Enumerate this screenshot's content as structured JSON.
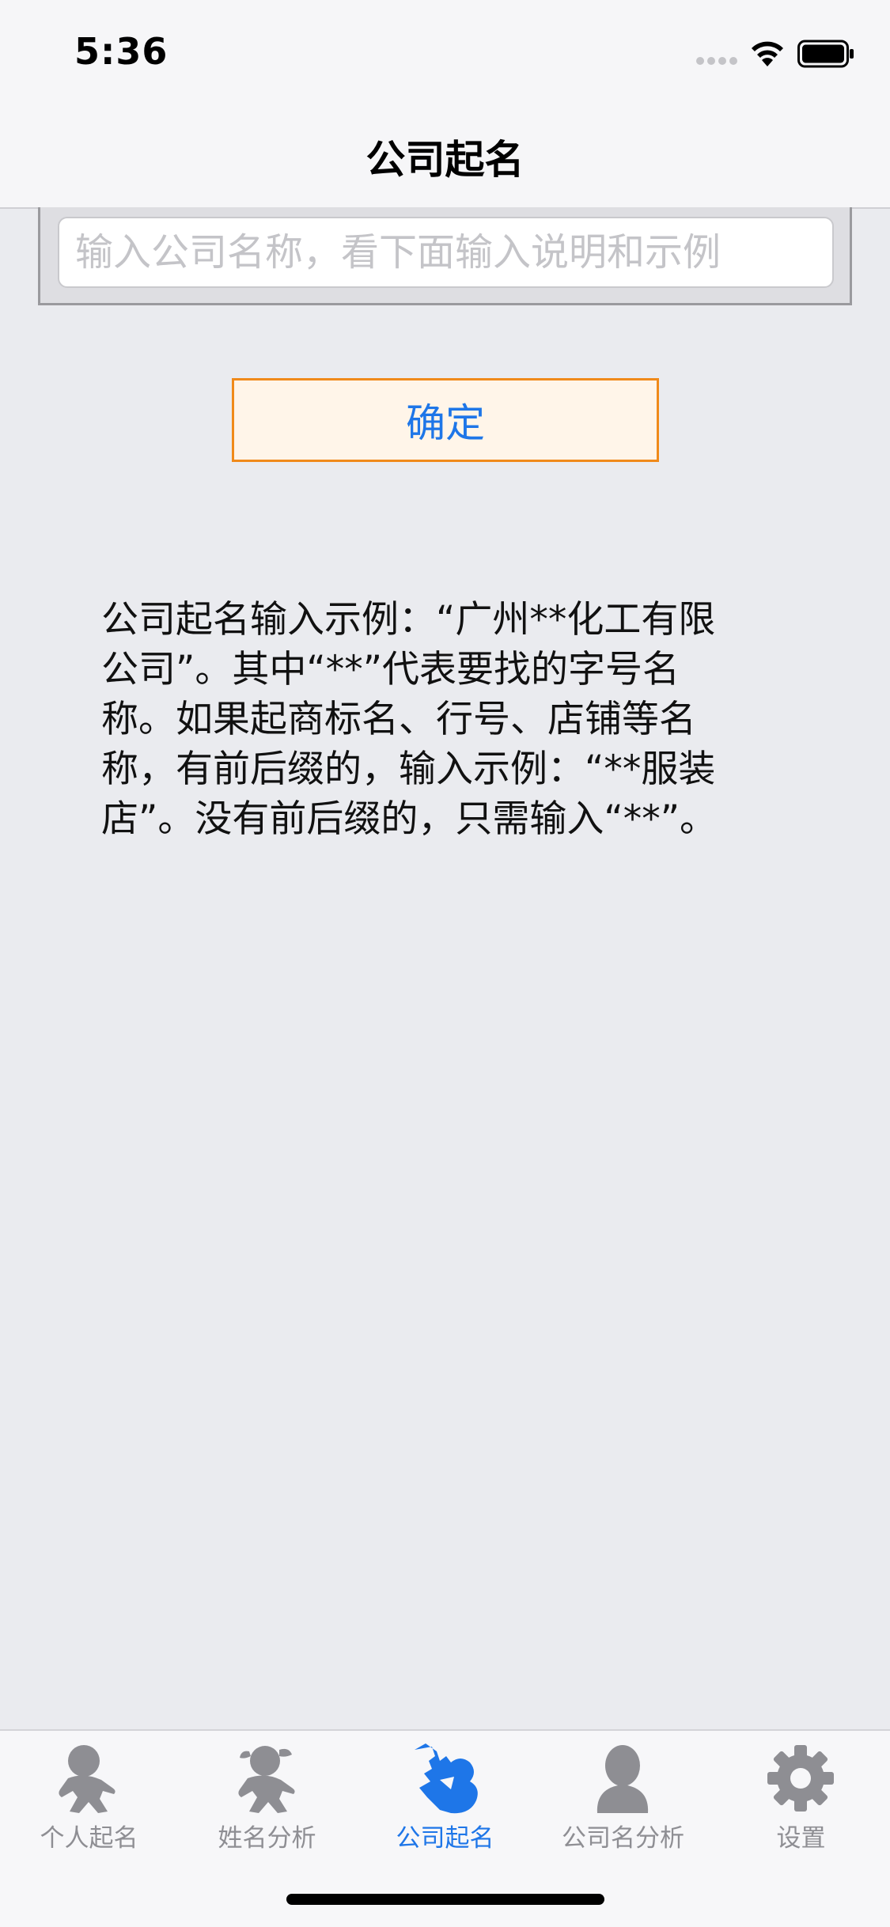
{
  "status_bar": {
    "time": "5:36"
  },
  "nav": {
    "title": "公司起名"
  },
  "form": {
    "input_placeholder": "输入公司名称，看下面输入说明和示例",
    "input_value": "",
    "confirm_label": "确定"
  },
  "instructions": {
    "text": "公司起名输入示例：“广州**化工有限\n公司”。其中“**”代表要找的字号名\n称。如果起商标名、行号、店铺等名\n称，有前后缀的，输入示例：“**服装\n店”。没有前后缀的，只需输入“**”。"
  },
  "tabbar": {
    "active_index": 2,
    "tabs": [
      {
        "label": "个人起名",
        "icon": "boy-icon"
      },
      {
        "label": "姓名分析",
        "icon": "girl-icon"
      },
      {
        "label": "公司起名",
        "icon": "company-icon"
      },
      {
        "label": "公司名分析",
        "icon": "person-icon"
      },
      {
        "label": "设置",
        "icon": "gear-icon"
      }
    ]
  },
  "colors": {
    "accent": "#1E76E8",
    "button_border": "#F08A1A",
    "button_fill": "#FFF5E9",
    "tab_inactive": "#8E8E93",
    "background": "#EAEBEF"
  }
}
